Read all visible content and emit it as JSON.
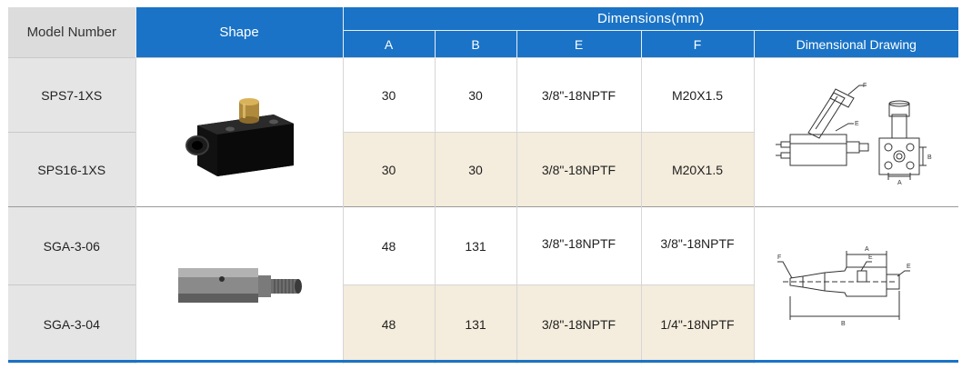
{
  "header": {
    "model_number": "Model Number",
    "shape": "Shape",
    "dimensions": "Dimensions(mm)",
    "col_a": "A",
    "col_b": "B",
    "col_e": "E",
    "col_f": "F",
    "dimensional_drawing": "Dimensional Drawing"
  },
  "rows": [
    {
      "model": "SPS7-1XS",
      "a": "30",
      "b": "30",
      "e": "3/8\"-18NPTF",
      "f": "M20X1.5"
    },
    {
      "model": "SPS16-1XS",
      "a": "30",
      "b": "30",
      "e": "3/8\"-18NPTF",
      "f": "M20X1.5"
    },
    {
      "model": "SGA-3-06",
      "a": "48",
      "b": "131",
      "e": "3/8\"-18NPTF",
      "f": "3/8\"-18NPTF"
    },
    {
      "model": "SGA-3-04",
      "a": "48",
      "b": "131",
      "e": "3/8\"-18NPTF",
      "f": "1/4\"-18NPTF"
    }
  ],
  "drawing_labels": {
    "sps_f": "F",
    "sps_e": "E",
    "sps_b": "B",
    "sps_a": "A",
    "sga_f": "F",
    "sga_e_top": "E",
    "sga_e_right": "E",
    "sga_a": "A",
    "sga_b": "B"
  },
  "colors": {
    "header_blue": "#1a73c6",
    "header_gray": "#dcdcdc",
    "model_gray": "#e5e5e5",
    "highlight_beige": "#f4ecdc"
  }
}
